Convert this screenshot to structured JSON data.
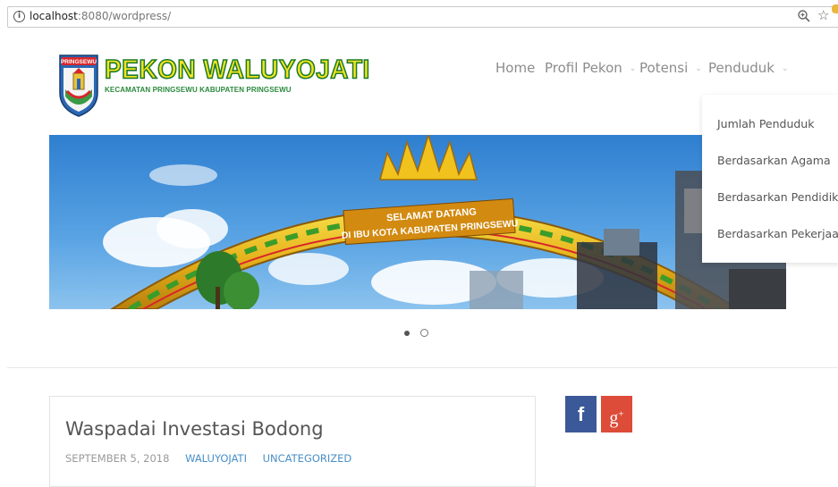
{
  "browser": {
    "url_host": "localhost",
    "url_rest": ":8080/wordpress/",
    "icons": {
      "info": "info-circle-icon",
      "zoom": "zoom-icon",
      "bookmark": "star-icon",
      "extension": "extension-icon"
    }
  },
  "site": {
    "title": "PEKON WALUYOJATI",
    "tagline": "KECAMATAN PRINGSEWU KABUPATEN PRINGSEWU",
    "crest_label": "PRINGSEWU",
    "colors": {
      "title_fill": "#f2e41d",
      "title_stroke": "#1d7a2b",
      "tagline": "#2a8a3b"
    }
  },
  "nav": {
    "items": [
      {
        "label": "Home",
        "has_submenu": false
      },
      {
        "label": "Profil Pekon",
        "has_submenu": true
      },
      {
        "label": "Potensi",
        "has_submenu": true
      },
      {
        "label": "Penduduk",
        "has_submenu": true
      }
    ],
    "chevron_glyph": "⌄",
    "dropdown": {
      "parent": "Penduduk",
      "items": [
        "Jumlah Penduduk",
        "Berdasarkan Agama",
        "Berdasarkan Pendidikan",
        "Berdasarkan Pekerjaan"
      ]
    }
  },
  "slider": {
    "banner_line1": "SELAMAT DATANG",
    "banner_line2": "DI IBU KOTA KABUPATEN PRINGSEWU",
    "slide_count": 2,
    "active_slide": 1
  },
  "post": {
    "title": "Waspadai Investasi Bodong",
    "date": "SEPTEMBER 5, 2018",
    "author": "WALUYOJATI",
    "category": "UNCATEGORIZED",
    "link_color": "#4a8fc7"
  },
  "social": {
    "facebook_glyph": "f",
    "googleplus_glyph": "g",
    "googleplus_sup": "+",
    "facebook_color": "#3b5998",
    "googleplus_color": "#dd4b39"
  }
}
